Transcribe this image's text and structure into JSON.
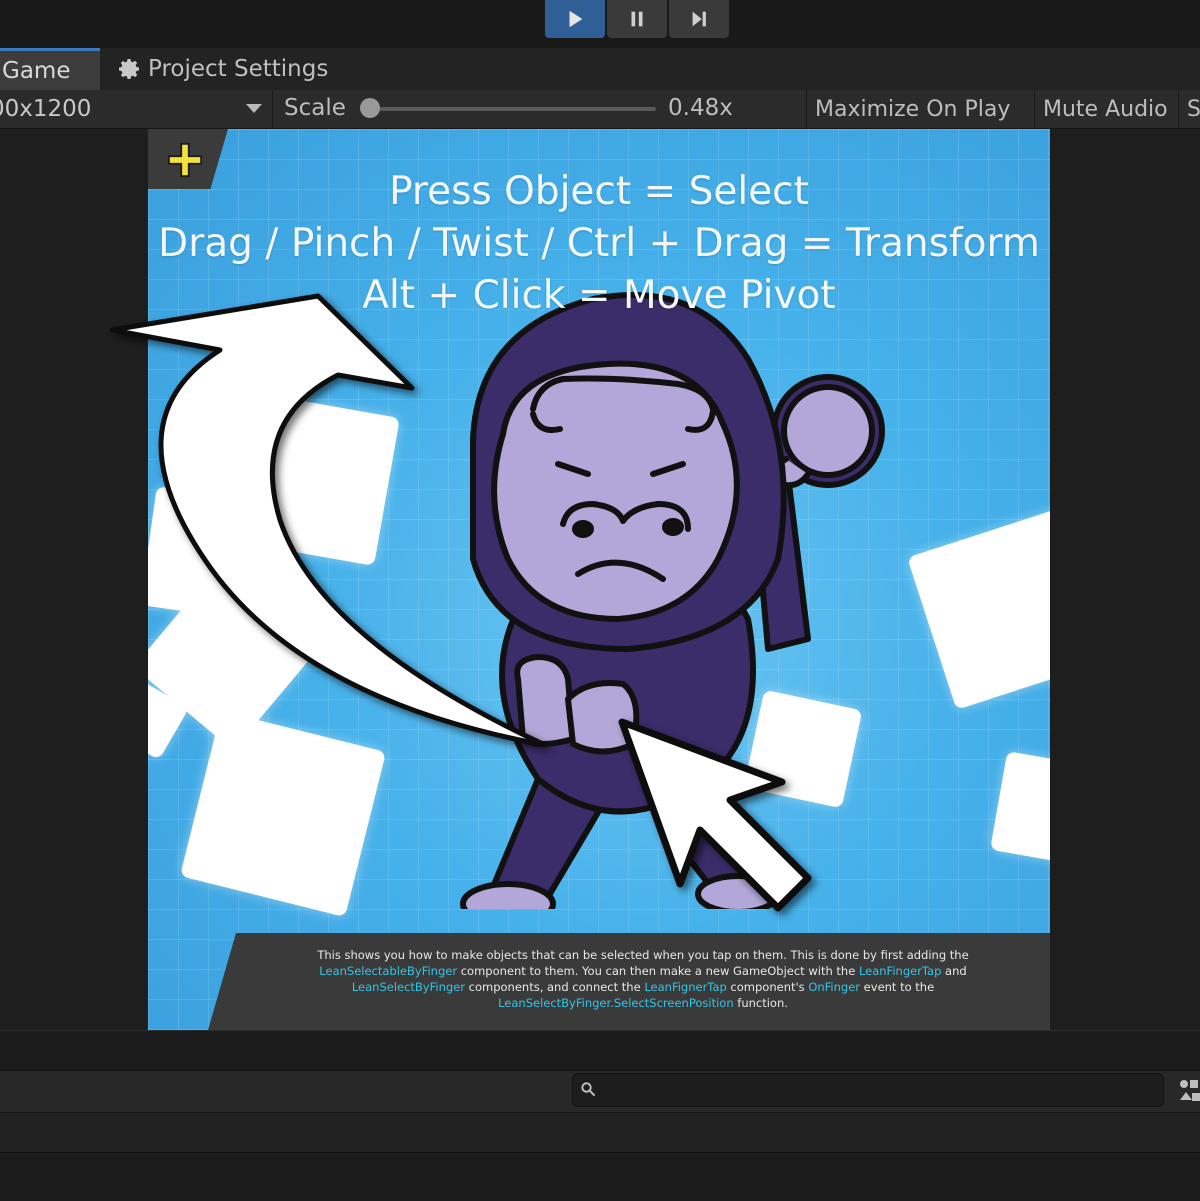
{
  "playbar": {
    "play_icon": "play-icon",
    "pause_icon": "pause-icon",
    "step_icon": "step-icon",
    "active_color": "#2f5f96"
  },
  "tabs": {
    "game": "Game",
    "project_settings": "Project Settings",
    "project_settings_icon": "gear-icon",
    "active_accent": "#3a79bb"
  },
  "toolbar": {
    "resolution": "00x1200",
    "scale_label": "Scale",
    "scale_value": "0.48x",
    "scale_fraction": 0.0,
    "maximize_on_play": "Maximize On Play",
    "mute_audio": "Mute Audio",
    "stats": "S"
  },
  "game": {
    "background_color": "#46b1ea",
    "plus_icon": "plus-icon",
    "plus_color": "#f2e23a",
    "hints": [
      "Press Object = Select",
      "Drag / Pinch / Twist / Ctrl + Drag = Transform",
      "Alt + Click = Move Pivot"
    ],
    "info": {
      "p1": "This shows you how to make objects that can be selected when you tap on them. This is done by first adding the",
      "c1": "LeanSelectableByFinger",
      "p2": " component to them. You can then make a new GameObject with the ",
      "c2": "LeanFingerTap",
      "p3": " and",
      "c3": "LeanSelectByFinger",
      "p4": " components, and connect the ",
      "c4": "LeanFignerTap",
      "p5": " component's ",
      "c5": "OnFinger",
      "p6": " event to the",
      "c6": "LeanSelectByFinger.SelectScreenPosition",
      "p7": " function.",
      "highlight_color": "#32c6e6"
    },
    "character": "gorilla-character"
  },
  "bottom": {
    "search_icon": "search-icon",
    "search_value": ""
  }
}
